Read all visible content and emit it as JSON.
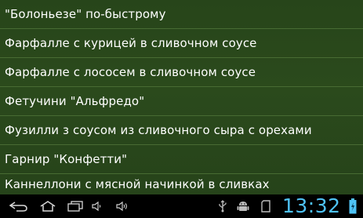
{
  "recipes": {
    "items": [
      {
        "label": "\"Болоньезе\" по-быстрому"
      },
      {
        "label": "Фарфалле с курицей в сливочном соусе"
      },
      {
        "label": "Фарфалле с лососем в сливочном соусе"
      },
      {
        "label": "Фетучини \"Альфредо\""
      },
      {
        "label": "Фузилли з соусом из сливочного сыра с орехами"
      },
      {
        "label": "Гарнир \"Конфетти\""
      },
      {
        "label": "Каннеллони с мясной начинкой в сливках"
      }
    ]
  },
  "system_bar": {
    "time": "13:32",
    "icons": {
      "back": "back-icon",
      "home": "home-icon",
      "recents": "recents-icon",
      "volume_down": "volume-down-icon",
      "volume_up": "volume-up-icon",
      "usb": "usb-icon",
      "android": "android-debug-icon",
      "sd_card": "sd-card-icon",
      "battery": "battery-charging-icon"
    },
    "clock_color": "#4fc3f7"
  },
  "colors": {
    "background": "#2b4a1c",
    "divider": "#486b33",
    "text": "#ffffff"
  }
}
